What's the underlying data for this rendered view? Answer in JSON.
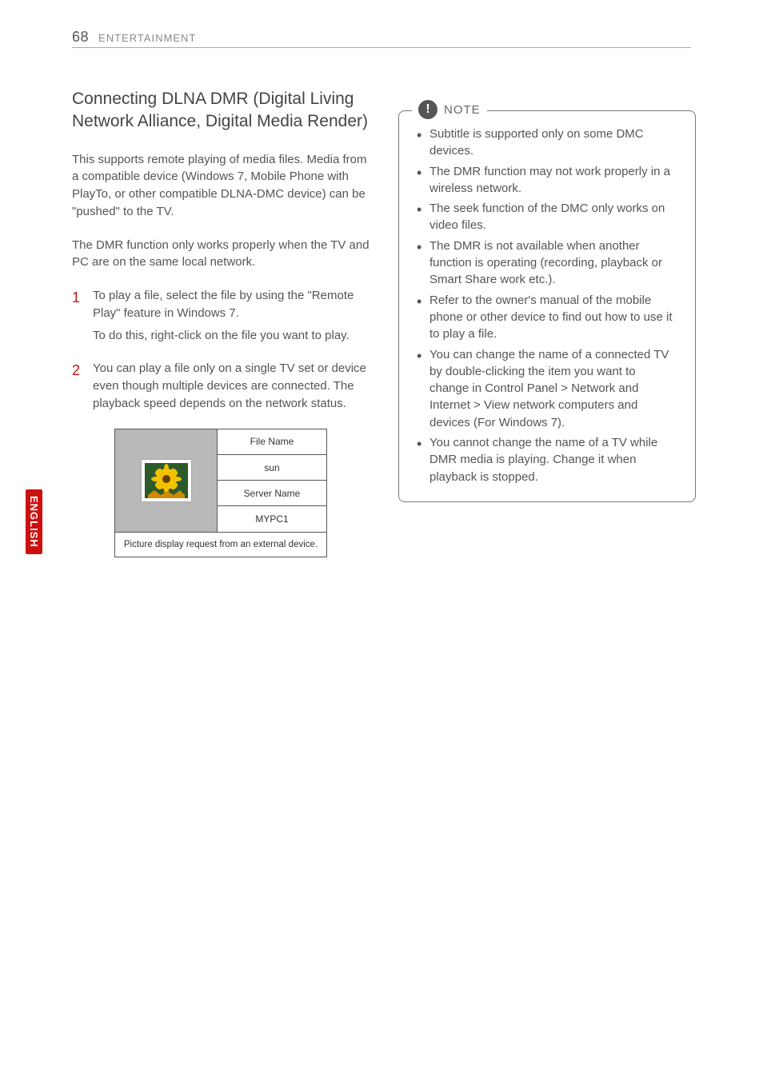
{
  "header": {
    "page_number": "68",
    "section_label": "ENTERTAINMENT"
  },
  "side_tab": "ENGLISH",
  "left": {
    "title": "Connecting DLNA DMR (Digital Living Network Alliance, Digital Media Render)",
    "intro1": "This supports remote playing of media files. Media from a compatible device (Windows 7, Mobile Phone with PlayTo, or other compatible DLNA-DMC device) can be \"pushed\" to the TV.",
    "intro2": "The DMR function only works properly when the TV and PC are on the same local network.",
    "steps": [
      {
        "num": "1",
        "p1": "To play a file, select the file by using the \"Remote Play\" feature in Windows 7.",
        "p2": "To do this, right-click on the file you want to play."
      },
      {
        "num": "2",
        "p1": "You can play a file only on a single TV set or device even though multiple devices are connected. The playback speed depends on the network status."
      }
    ],
    "diagram": {
      "labels": {
        "file_name": "File Name",
        "sun": "sun",
        "server_name": "Server Name",
        "mypc1": "MYPC1"
      },
      "caption": "Picture display request from an external device."
    }
  },
  "note": {
    "title": "NOTE",
    "bullets": [
      "Subtitle is supported only on some DMC devices.",
      "The DMR function may not work properly in a wireless network.",
      "The seek function of the DMC only works on video files.",
      "The DMR is not available when another function is operating (recording, playback or Smart Share work etc.).",
      "Refer to the owner's manual of the mobile phone or other device to find out how to use it to play a file.",
      "You can change the name of a connected TV by double-clicking the item you want to change in Control Panel > Network and Internet > View network computers and devices (For Windows 7).",
      "You cannot change the name of a TV while DMR media is playing. Change it when playback is stopped."
    ]
  }
}
